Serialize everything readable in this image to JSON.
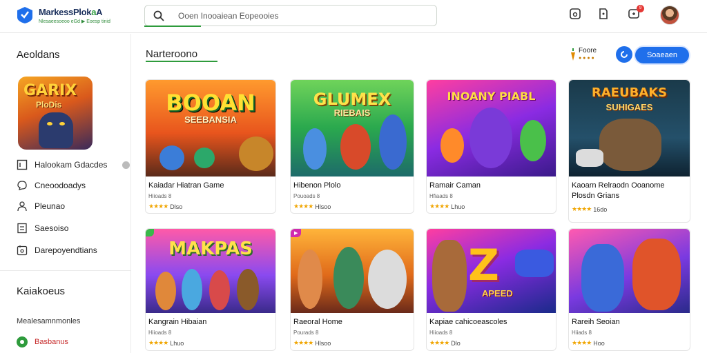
{
  "header": {
    "logo_title_main": "MarkessPlok",
    "logo_title_accent": "a",
    "logo_title_end": "A",
    "logo_subtitle": "Nlesaeesoeoo eGd ▶ Eoesp tinid",
    "search_placeholder": "Ooen Inooaiean Eopeooies",
    "notification_count": "9"
  },
  "sidebar": {
    "title": "Aeoldans",
    "app_thumb_title": "GARIX",
    "app_thumb_sub": "PloDis",
    "items": [
      {
        "label": "Halookam Gdacdes",
        "icon": "window-icon"
      },
      {
        "label": "Cneoodoadys",
        "icon": "chat-icon"
      },
      {
        "label": "Pleunao",
        "icon": "user-icon"
      },
      {
        "label": "Saesoiso",
        "icon": "list-icon"
      },
      {
        "label": "Darepoyendtians",
        "icon": "calendar-icon"
      }
    ],
    "section2_title": "Kaiakoeus",
    "section2_sub": "Mealesamnmonles",
    "section2_highlight": "Basbanus"
  },
  "main": {
    "section_title": "Narteroono",
    "filter_label": "Foore",
    "filter_sub": "● ● ● ●",
    "primary_button": "Soaeaen"
  },
  "cards": [
    {
      "art_title": "BOOAN",
      "art_sub": "SEEBANSIA",
      "name": "Kaiadar Hiatran Game",
      "meta": "Hiioads 8",
      "stars": "★★★★",
      "rating": "Dlso"
    },
    {
      "art_title": "GLUMEX",
      "art_sub": "RIEBAIS",
      "name": "Hibenon Plolo",
      "meta": "Pouoads 8",
      "stars": "★★★★",
      "rating": "Hlsoo"
    },
    {
      "art_title": "INOANY PIABL",
      "art_sub": "",
      "name": "Ramair Caman",
      "meta": "Hfiaads 8",
      "stars": "★★★★",
      "rating": "Lhuo"
    },
    {
      "art_title": "RAEUBAKS",
      "art_sub": "SUHIGAES",
      "name": "Kaoarn Relraodn Ooanome Plosdn Grians",
      "meta": "",
      "stars": "★★★★",
      "rating": "16do"
    },
    {
      "art_title": "MAKPAS",
      "art_sub": "",
      "name": "Kangrain Hibaian",
      "meta": "Hiioads 8",
      "stars": "★★★★",
      "rating": "Lhuo",
      "tag": ""
    },
    {
      "art_title": "",
      "art_sub": "",
      "name": "Raeoral Home",
      "meta": "Pourads 8",
      "stars": "★★★★",
      "rating": "Hlsoo",
      "tag": "▶"
    },
    {
      "art_title": "Z",
      "art_sub": "APEED",
      "name": "Kapiae cahicoeascoles",
      "meta": "Hiioads 8",
      "stars": "★★★★",
      "rating": "Dlo"
    },
    {
      "art_title": "",
      "art_sub": "",
      "name": "Rareih Seoian",
      "meta": "Hiiads 8",
      "stars": "★★★★",
      "rating": "Hoo"
    }
  ]
}
